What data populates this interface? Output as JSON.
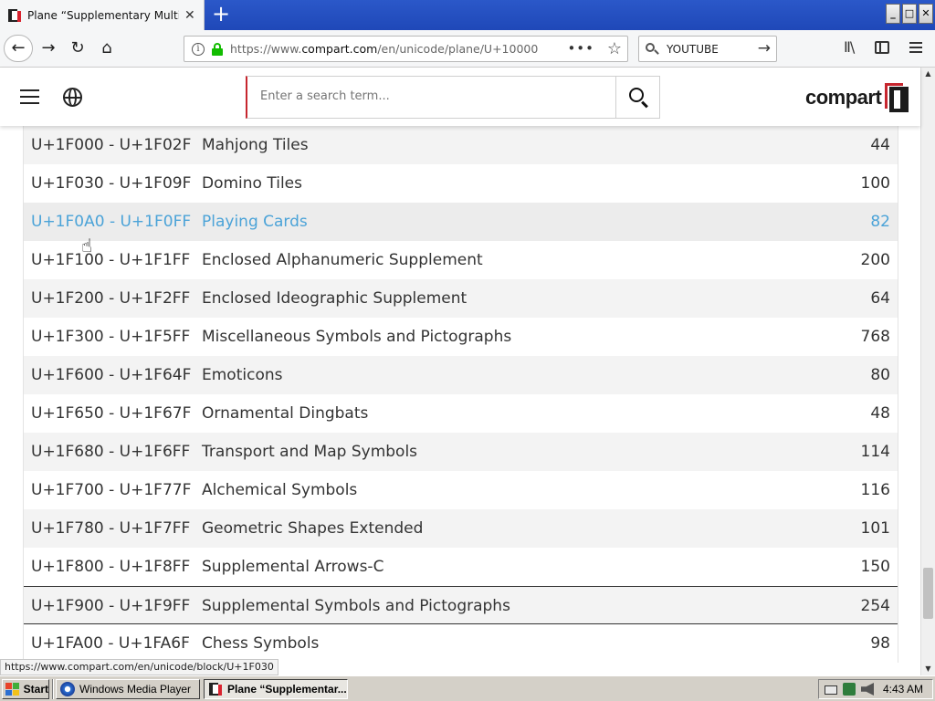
{
  "browser": {
    "tab_title": "Plane “Supplementary Multilingual",
    "tab_close": "✕",
    "new_tab": "+",
    "url_host_prefix": "https://www.",
    "url_host": "compart.com",
    "url_path": "/en/unicode/plane/U+10000",
    "url_more": "•••",
    "search_value": "YOUTUBE",
    "window_buttons": [
      "_",
      "□",
      "✕"
    ]
  },
  "site": {
    "search_placeholder": "Enter a search term...",
    "logo_text": "compart"
  },
  "blocks": [
    {
      "range": "U+1F000 - U+1F02F",
      "name": "Mahjong Tiles",
      "count": "44"
    },
    {
      "range": "U+1F030 - U+1F09F",
      "name": "Domino Tiles",
      "count": "100"
    },
    {
      "range": "U+1F0A0 - U+1F0FF",
      "name": "Playing Cards",
      "count": "82"
    },
    {
      "range": "U+1F100 - U+1F1FF",
      "name": "Enclosed Alphanumeric Supplement",
      "count": "200"
    },
    {
      "range": "U+1F200 - U+1F2FF",
      "name": "Enclosed Ideographic Supplement",
      "count": "64"
    },
    {
      "range": "U+1F300 - U+1F5FF",
      "name": "Miscellaneous Symbols and Pictographs",
      "count": "768"
    },
    {
      "range": "U+1F600 - U+1F64F",
      "name": "Emoticons",
      "count": "80"
    },
    {
      "range": "U+1F650 - U+1F67F",
      "name": "Ornamental Dingbats",
      "count": "48"
    },
    {
      "range": "U+1F680 - U+1F6FF",
      "name": "Transport and Map Symbols",
      "count": "114"
    },
    {
      "range": "U+1F700 - U+1F77F",
      "name": "Alchemical Symbols",
      "count": "116"
    },
    {
      "range": "U+1F780 - U+1F7FF",
      "name": "Geometric Shapes Extended",
      "count": "101"
    },
    {
      "range": "U+1F800 - U+1F8FF",
      "name": "Supplemental Arrows-C",
      "count": "150"
    },
    {
      "range": "U+1F900 - U+1F9FF",
      "name": "Supplemental Symbols and Pictographs",
      "count": "254"
    },
    {
      "range": "U+1FA00 - U+1FA6F",
      "name": "Chess Symbols",
      "count": "98"
    }
  ],
  "status_link": "https://www.compart.com/en/unicode/block/U+1F030",
  "taskbar": {
    "start_label": "Start",
    "tasks": [
      "Windows Media Player",
      "Plane “Supplementar..."
    ],
    "clock": "4:43 AM"
  },
  "colors": {
    "link_hover": "#4ba3d8",
    "accent_red": "#c6262e",
    "lock_green": "#12bc00",
    "titlebar_blue": "#2b58c9"
  }
}
